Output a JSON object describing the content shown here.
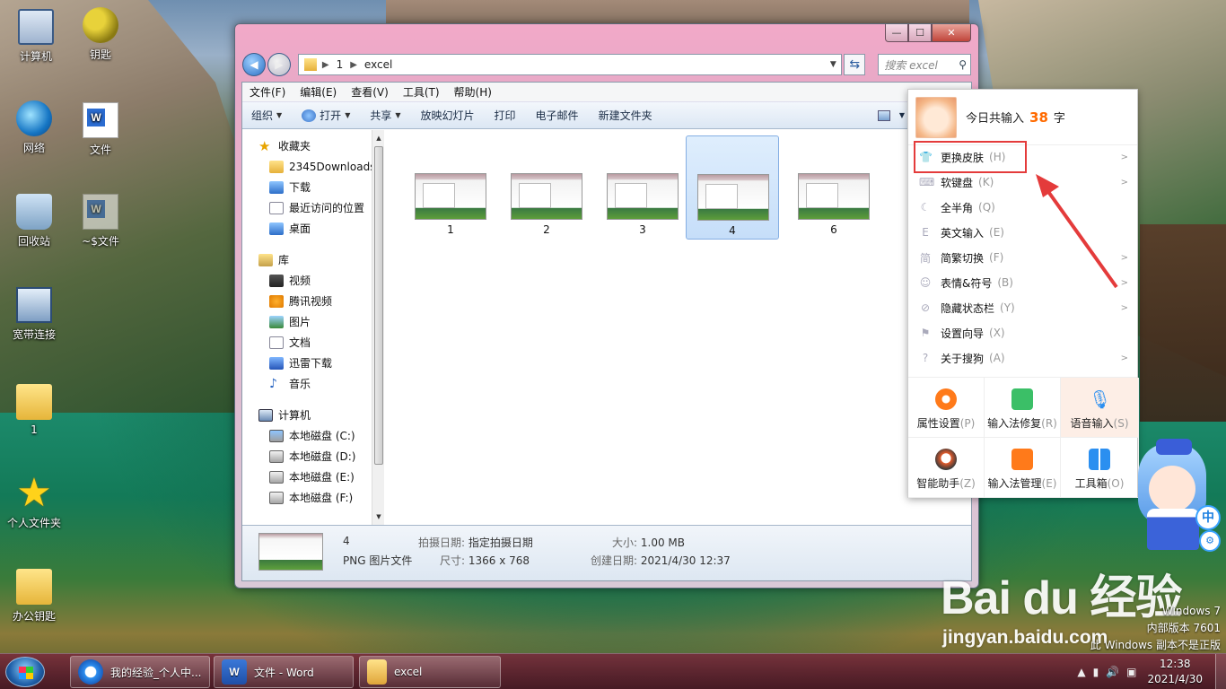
{
  "desktop": {
    "icons": [
      {
        "label": "计算机",
        "icon": "computer-icon"
      },
      {
        "label": "钥匙",
        "icon": "key-icon"
      },
      {
        "label": "网络",
        "icon": "network-icon"
      },
      {
        "label": "文件",
        "icon": "word-doc-icon"
      },
      {
        "label": "回收站",
        "icon": "recycle-bin-icon"
      },
      {
        "label": "~$文件",
        "icon": "word-doc-icon"
      },
      {
        "label": "宽带连接",
        "icon": "broadband-icon"
      },
      {
        "label": "1",
        "icon": "folder-icon"
      },
      {
        "label": "个人文件夹",
        "icon": "star-icon"
      },
      {
        "label": "办公钥匙",
        "icon": "folder-icon"
      }
    ]
  },
  "explorer": {
    "window_controls": {
      "min": "—",
      "max": "☐",
      "close": "✕"
    },
    "address": {
      "segments": [
        "1",
        "excel"
      ]
    },
    "search_placeholder": "搜索 excel",
    "menu": [
      "文件(F)",
      "编辑(E)",
      "查看(V)",
      "工具(T)",
      "帮助(H)"
    ],
    "commands": {
      "organize": "组织",
      "open": "打开",
      "share": "共享",
      "slideshow": "放映幻灯片",
      "print": "打印",
      "email": "电子邮件",
      "new_folder": "新建文件夹"
    },
    "nav": {
      "favorites": "收藏夹",
      "fav_items": [
        "2345Downloads",
        "下载",
        "最近访问的位置",
        "桌面"
      ],
      "libraries": "库",
      "lib_items": [
        "视频",
        "腾讯视频",
        "图片",
        "文档",
        "迅雷下载",
        "音乐"
      ],
      "computer": "计算机",
      "drives": [
        "本地磁盘 (C:)",
        "本地磁盘 (D:)",
        "本地磁盘 (E:)",
        "本地磁盘 (F:)"
      ]
    },
    "files": [
      {
        "name": "1",
        "selected": false
      },
      {
        "name": "2",
        "selected": false
      },
      {
        "name": "3",
        "selected": false
      },
      {
        "name": "4",
        "selected": true
      },
      {
        "name": "6",
        "selected": false
      }
    ],
    "details": {
      "name": "4",
      "type": "PNG 图片文件",
      "date_taken_label": "拍摄日期:",
      "date_taken": "指定拍摄日期",
      "dimensions_label": "尺寸:",
      "dimensions": "1366 x 768",
      "size_label": "大小:",
      "size": "1.00 MB",
      "created_label": "创建日期:",
      "created": "2021/4/30 12:37"
    }
  },
  "ime": {
    "today_label": "今日共输入",
    "today_count": "38",
    "today_unit": "字",
    "items": [
      {
        "label": "更换皮肤",
        "key": "(H)",
        "icon": "shirt-icon",
        "submenu": true
      },
      {
        "label": "软键盘",
        "key": "(K)",
        "icon": "keyboard-icon",
        "submenu": true
      },
      {
        "label": "全半角",
        "key": "(Q)",
        "icon": "moon-icon",
        "submenu": false
      },
      {
        "label": "英文输入",
        "key": "(E)",
        "icon": "english-icon",
        "submenu": false
      },
      {
        "label": "简繁切换",
        "key": "(F)",
        "icon": "traditional-icon",
        "submenu": true
      },
      {
        "label": "表情&符号",
        "key": "(B)",
        "icon": "smiley-icon",
        "submenu": true
      },
      {
        "label": "隐藏状态栏",
        "key": "(Y)",
        "icon": "hide-icon",
        "submenu": true
      },
      {
        "label": "设置向导",
        "key": "(X)",
        "icon": "flag-icon",
        "submenu": false
      },
      {
        "label": "关于搜狗",
        "key": "(A)",
        "icon": "question-icon",
        "submenu": true
      }
    ],
    "grid": [
      {
        "label": "属性设置",
        "key": "(P)",
        "icon": "gear-icon"
      },
      {
        "label": "输入法修复",
        "key": "(R)",
        "icon": "repair-icon"
      },
      {
        "label": "语音输入",
        "key": "(S)",
        "icon": "mic-icon"
      },
      {
        "label": "智能助手",
        "key": "(Z)",
        "icon": "robot-icon"
      },
      {
        "label": "输入法管理",
        "key": "(E)",
        "icon": "manager-icon"
      },
      {
        "label": "工具箱",
        "key": "(O)",
        "icon": "toolbox-icon"
      }
    ],
    "accent": "#ff6a00",
    "highlight_color": "#e43b3b"
  },
  "mascot": {
    "badge_mode": "中"
  },
  "watermark": {
    "brand": "Bai du 经验",
    "url": "jingyan.baidu.com"
  },
  "windows_notice": {
    "line1": "Windows 7",
    "line2": "内部版本 7601",
    "line3": "此 Windows 副本不是正版"
  },
  "taskbar": {
    "tasks": [
      {
        "label": "我的经验_个人中...",
        "icon": "browser-icon"
      },
      {
        "label": "文件 - Word",
        "icon": "word-icon"
      },
      {
        "label": "excel",
        "icon": "folder-icon"
      }
    ],
    "time": "12:38",
    "date": "2021/4/30"
  }
}
